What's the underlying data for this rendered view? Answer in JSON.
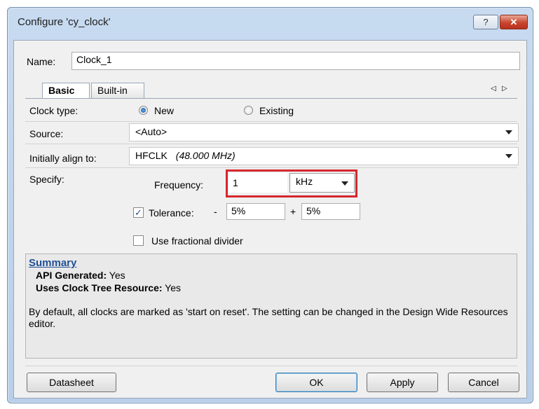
{
  "window": {
    "title": "Configure 'cy_clock'",
    "help_glyph": "?",
    "close_glyph": "✕"
  },
  "name_row": {
    "label": "Name:",
    "value": "Clock_1"
  },
  "tabs": [
    {
      "label": "Basic"
    },
    {
      "label": "Built-in"
    }
  ],
  "tab_scroll": {
    "left": "◁",
    "right": "▷"
  },
  "clock_type": {
    "label": "Clock type:",
    "options": [
      "New",
      "Existing"
    ],
    "selected": "New"
  },
  "source": {
    "label": "Source:",
    "value": "<Auto>"
  },
  "align": {
    "label": "Initially align to:",
    "value": "HFCLK",
    "detail": "(48.000 MHz)"
  },
  "specify": {
    "label": "Specify:",
    "frequency_label": "Frequency:",
    "frequency_value": "1",
    "unit": "kHz",
    "tolerance_checked": true,
    "tolerance_label": "Tolerance:",
    "minus_sign": "-",
    "minus_value": "5%",
    "plus_sign": "+",
    "plus_value": "5%",
    "fractional_label": "Use fractional divider",
    "fractional_checked": false
  },
  "summary": {
    "heading": "Summary",
    "api_key": "API Generated:",
    "api_val": "Yes",
    "tree_key": "Uses Clock Tree Resource:",
    "tree_val": "Yes",
    "note": "By default, all clocks are marked as 'start on reset'. The setting can be changed in the Design Wide Resources editor."
  },
  "buttons": {
    "datasheet": "Datasheet",
    "ok": "OK",
    "apply": "Apply",
    "cancel": "Cancel"
  },
  "colors": {
    "highlight": "#d6262d",
    "summary_link": "#1f4e96"
  }
}
